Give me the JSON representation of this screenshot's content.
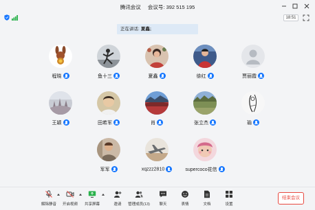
{
  "window": {
    "app_name": "腾讯会议",
    "meeting_id_label": "会议号:",
    "meeting_id": "392 515 195"
  },
  "status": {
    "clock": "18:51"
  },
  "speaking": {
    "label": "正在讲话:",
    "name": "夏鑫;"
  },
  "participants": [
    {
      "name": "程晓"
    },
    {
      "name": "鱼十三"
    },
    {
      "name": "夏鑫"
    },
    {
      "name": "徐红"
    },
    {
      "name": "贾丽霞"
    },
    {
      "name": "王颖"
    },
    {
      "name": "田希军"
    },
    {
      "name": "肖"
    },
    {
      "name": "张立杰"
    },
    {
      "name": "瑜"
    },
    {
      "name": "军军"
    },
    {
      "name": "xqzzz2810"
    },
    {
      "name": "supercoco花信"
    }
  ],
  "toolbar": {
    "mute": "解除静音",
    "video": "开启视频",
    "share": "共享屏幕",
    "invite": "邀请",
    "members": "管理成员(13)",
    "chat": "聊天",
    "reactions": "表情",
    "docs": "文档",
    "settings": "设置",
    "end": "结束会议"
  },
  "colors": {
    "accent": "#1677ff",
    "end": "#e8483f",
    "banner": "#dde9f6"
  }
}
